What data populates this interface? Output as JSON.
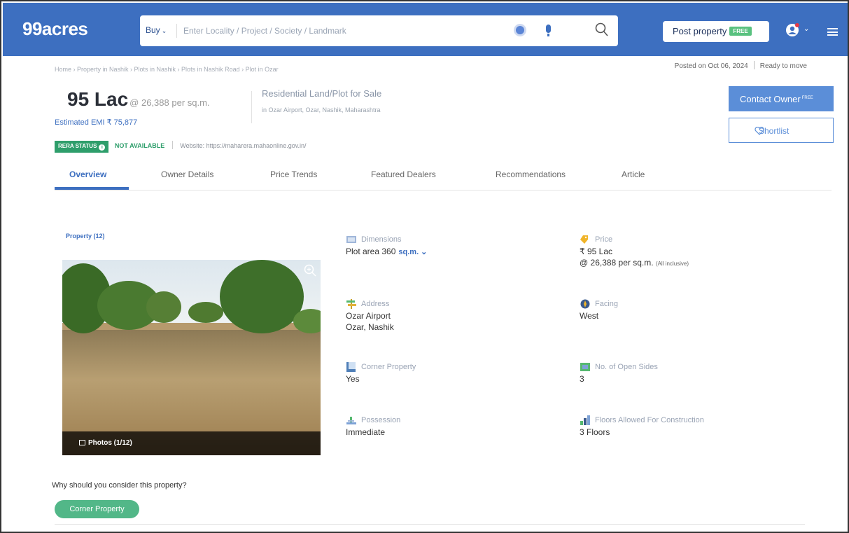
{
  "header": {
    "logo": "99acres",
    "buy_label": "Buy",
    "search_placeholder": "Enter Locality / Project / Society / Landmark",
    "post_property_label": "Post property",
    "free_badge": "FREE"
  },
  "breadcrumb": "Home › Property in Nashik › Plots in Nashik › Plots in Nashik Road › Plot in Ozar",
  "posted": {
    "date": "Posted on Oct 06, 2024",
    "status": "Ready to move"
  },
  "listing": {
    "price": "95 Lac",
    "rate": "@ 26,388 per sq.m.",
    "emi": "Estimated EMI ₹ 75,877",
    "type": "Residential Land/Plot for Sale",
    "location": "in Ozar Airport, Ozar, Nashik, Maharashtra"
  },
  "actions": {
    "contact_label": "Contact Owner",
    "contact_sup": "FREE",
    "shortlist_label": "Shortlist"
  },
  "rera": {
    "status_label": "RERA STATUS",
    "availability": "NOT AVAILABLE",
    "website": "Website: https://maharera.mahaonline.gov.in/"
  },
  "tabs": [
    "Overview",
    "Owner Details",
    "Price Trends",
    "Featured Dealers",
    "Recommendations",
    "Article"
  ],
  "property_count": "Property (12)",
  "photos_label": "Photos (1/12)",
  "features": {
    "dimensions": {
      "label": "Dimensions",
      "value": "Plot area 360",
      "unit": "sq.m."
    },
    "price": {
      "label": "Price",
      "value": "₹ 95 Lac",
      "rate": "@ 26,388 per sq.m.",
      "note": "(All inclusive)"
    },
    "address": {
      "label": "Address",
      "line1": "Ozar Airport",
      "line2": "Ozar, Nashik"
    },
    "facing": {
      "label": "Facing",
      "value": "West"
    },
    "corner": {
      "label": "Corner Property",
      "value": "Yes"
    },
    "open_sides": {
      "label": "No. of Open Sides",
      "value": "3"
    },
    "possession": {
      "label": "Possession",
      "value": "Immediate"
    },
    "floors": {
      "label": "Floors Allowed For Construction",
      "value": "3 Floors"
    }
  },
  "why_heading": "Why should you consider this property?",
  "chip": "Corner Property",
  "colors": {
    "brand": "#3d6fc0",
    "accent_green": "#52b788",
    "rera_green": "#2e9e6b"
  }
}
